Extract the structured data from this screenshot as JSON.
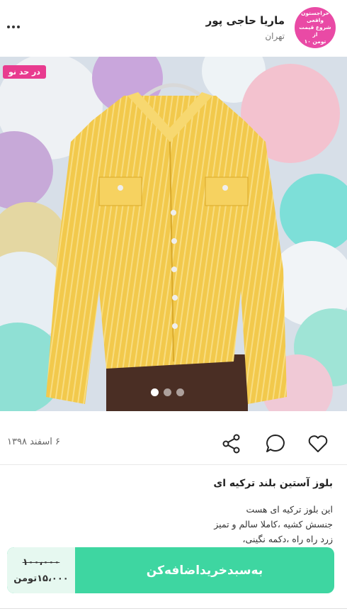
{
  "seller": {
    "name": "ماریا حاجی پور",
    "city": "تهران",
    "avatar_text": [
      "حراجستون واقعی",
      "شروع قیمت از",
      "۱۰ تومن"
    ]
  },
  "product": {
    "condition_badge": "در حد نو",
    "image_count": 3,
    "active_image_index": 1,
    "date": "۶ اسفند ۱۳۹۸",
    "title": "بلوز آستین بلند ترکیه ای",
    "description_lines": [
      "این بلوز  ترکیه ای هست",
      "جنسش کشیه ،کاملا سالم و تمیز",
      "زرد راه راه ،دکمه نگینی،"
    ]
  },
  "purchase": {
    "old_price": "۱۰۰،۰۰۰",
    "new_price": "۱۵،۰۰۰تومن",
    "add_to_cart": "به‌سبد‌خرید‌اضافه‌کن"
  },
  "icons": {
    "more": "more-icon",
    "like": "heart-icon",
    "comment": "comment-icon",
    "share": "share-icon"
  },
  "colors": {
    "brand_pink": "#e94aa5",
    "badge_pink": "#e83b8f",
    "cart_green": "#3ed6a1",
    "price_bg": "#e6f8f0"
  }
}
